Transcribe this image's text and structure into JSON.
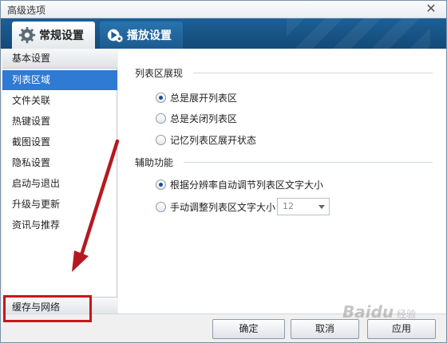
{
  "window": {
    "title": "高级选项",
    "close_glyph": "✕"
  },
  "tabs": [
    {
      "label": "常规设置",
      "icon": "gear-icon",
      "active": true
    },
    {
      "label": "播放设置",
      "icon": "play-settings-icon",
      "active": false
    }
  ],
  "sidebar": {
    "items": [
      {
        "label": "基本设置",
        "kind": "section"
      },
      {
        "label": "列表区域",
        "kind": "item",
        "selected": true
      },
      {
        "label": "文件关联",
        "kind": "item"
      },
      {
        "label": "热键设置",
        "kind": "item"
      },
      {
        "label": "截图设置",
        "kind": "item"
      },
      {
        "label": "隐私设置",
        "kind": "item"
      },
      {
        "label": "启动与退出",
        "kind": "item"
      },
      {
        "label": "升级与更新",
        "kind": "item"
      },
      {
        "label": "资讯与推荐",
        "kind": "item"
      }
    ],
    "bottom_section": {
      "label": "缓存与网络",
      "highlighted": true
    }
  },
  "content": {
    "list_display": {
      "heading": "列表区展现",
      "options": [
        {
          "label": "总是展开列表区",
          "checked": true
        },
        {
          "label": "总是关闭列表区",
          "checked": false
        },
        {
          "label": "记忆列表区展开状态",
          "checked": false
        }
      ]
    },
    "assist": {
      "heading": "辅助功能",
      "options": [
        {
          "label": "根据分辨率自动调节列表区文字大小",
          "checked": true
        },
        {
          "label": "手动调整列表区文字大小",
          "checked": false
        }
      ],
      "font_size_value": "12"
    }
  },
  "footer": {
    "ok_label": "确定",
    "cancel_label": "取消",
    "apply_label": "应用"
  },
  "watermark": {
    "text": "Baidu",
    "sub": "经验"
  },
  "colors": {
    "accent": "#2f7ad2",
    "tabbar": "#1d5f95",
    "highlight": "#c8161d"
  }
}
